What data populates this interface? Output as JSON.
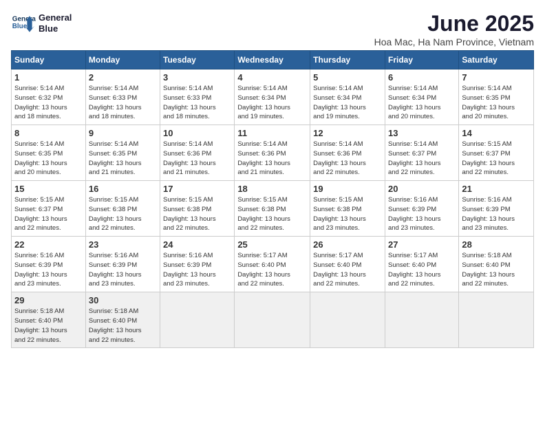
{
  "logo": {
    "line1": "General",
    "line2": "Blue"
  },
  "title": "June 2025",
  "subtitle": "Hoa Mac, Ha Nam Province, Vietnam",
  "days_of_week": [
    "Sunday",
    "Monday",
    "Tuesday",
    "Wednesday",
    "Thursday",
    "Friday",
    "Saturday"
  ],
  "weeks": [
    [
      {
        "day": "1",
        "info": "Sunrise: 5:14 AM\nSunset: 6:32 PM\nDaylight: 13 hours\nand 18 minutes."
      },
      {
        "day": "2",
        "info": "Sunrise: 5:14 AM\nSunset: 6:33 PM\nDaylight: 13 hours\nand 18 minutes."
      },
      {
        "day": "3",
        "info": "Sunrise: 5:14 AM\nSunset: 6:33 PM\nDaylight: 13 hours\nand 18 minutes."
      },
      {
        "day": "4",
        "info": "Sunrise: 5:14 AM\nSunset: 6:34 PM\nDaylight: 13 hours\nand 19 minutes."
      },
      {
        "day": "5",
        "info": "Sunrise: 5:14 AM\nSunset: 6:34 PM\nDaylight: 13 hours\nand 19 minutes."
      },
      {
        "day": "6",
        "info": "Sunrise: 5:14 AM\nSunset: 6:34 PM\nDaylight: 13 hours\nand 20 minutes."
      },
      {
        "day": "7",
        "info": "Sunrise: 5:14 AM\nSunset: 6:35 PM\nDaylight: 13 hours\nand 20 minutes."
      }
    ],
    [
      {
        "day": "8",
        "info": "Sunrise: 5:14 AM\nSunset: 6:35 PM\nDaylight: 13 hours\nand 20 minutes."
      },
      {
        "day": "9",
        "info": "Sunrise: 5:14 AM\nSunset: 6:35 PM\nDaylight: 13 hours\nand 21 minutes."
      },
      {
        "day": "10",
        "info": "Sunrise: 5:14 AM\nSunset: 6:36 PM\nDaylight: 13 hours\nand 21 minutes."
      },
      {
        "day": "11",
        "info": "Sunrise: 5:14 AM\nSunset: 6:36 PM\nDaylight: 13 hours\nand 21 minutes."
      },
      {
        "day": "12",
        "info": "Sunrise: 5:14 AM\nSunset: 6:36 PM\nDaylight: 13 hours\nand 22 minutes."
      },
      {
        "day": "13",
        "info": "Sunrise: 5:14 AM\nSunset: 6:37 PM\nDaylight: 13 hours\nand 22 minutes."
      },
      {
        "day": "14",
        "info": "Sunrise: 5:15 AM\nSunset: 6:37 PM\nDaylight: 13 hours\nand 22 minutes."
      }
    ],
    [
      {
        "day": "15",
        "info": "Sunrise: 5:15 AM\nSunset: 6:37 PM\nDaylight: 13 hours\nand 22 minutes."
      },
      {
        "day": "16",
        "info": "Sunrise: 5:15 AM\nSunset: 6:38 PM\nDaylight: 13 hours\nand 22 minutes."
      },
      {
        "day": "17",
        "info": "Sunrise: 5:15 AM\nSunset: 6:38 PM\nDaylight: 13 hours\nand 22 minutes."
      },
      {
        "day": "18",
        "info": "Sunrise: 5:15 AM\nSunset: 6:38 PM\nDaylight: 13 hours\nand 22 minutes."
      },
      {
        "day": "19",
        "info": "Sunrise: 5:15 AM\nSunset: 6:38 PM\nDaylight: 13 hours\nand 23 minutes."
      },
      {
        "day": "20",
        "info": "Sunrise: 5:16 AM\nSunset: 6:39 PM\nDaylight: 13 hours\nand 23 minutes."
      },
      {
        "day": "21",
        "info": "Sunrise: 5:16 AM\nSunset: 6:39 PM\nDaylight: 13 hours\nand 23 minutes."
      }
    ],
    [
      {
        "day": "22",
        "info": "Sunrise: 5:16 AM\nSunset: 6:39 PM\nDaylight: 13 hours\nand 23 minutes."
      },
      {
        "day": "23",
        "info": "Sunrise: 5:16 AM\nSunset: 6:39 PM\nDaylight: 13 hours\nand 23 minutes."
      },
      {
        "day": "24",
        "info": "Sunrise: 5:16 AM\nSunset: 6:39 PM\nDaylight: 13 hours\nand 23 minutes."
      },
      {
        "day": "25",
        "info": "Sunrise: 5:17 AM\nSunset: 6:40 PM\nDaylight: 13 hours\nand 22 minutes."
      },
      {
        "day": "26",
        "info": "Sunrise: 5:17 AM\nSunset: 6:40 PM\nDaylight: 13 hours\nand 22 minutes."
      },
      {
        "day": "27",
        "info": "Sunrise: 5:17 AM\nSunset: 6:40 PM\nDaylight: 13 hours\nand 22 minutes."
      },
      {
        "day": "28",
        "info": "Sunrise: 5:18 AM\nSunset: 6:40 PM\nDaylight: 13 hours\nand 22 minutes."
      }
    ],
    [
      {
        "day": "29",
        "info": "Sunrise: 5:18 AM\nSunset: 6:40 PM\nDaylight: 13 hours\nand 22 minutes."
      },
      {
        "day": "30",
        "info": "Sunrise: 5:18 AM\nSunset: 6:40 PM\nDaylight: 13 hours\nand 22 minutes."
      },
      {
        "day": "",
        "info": ""
      },
      {
        "day": "",
        "info": ""
      },
      {
        "day": "",
        "info": ""
      },
      {
        "day": "",
        "info": ""
      },
      {
        "day": "",
        "info": ""
      }
    ]
  ]
}
